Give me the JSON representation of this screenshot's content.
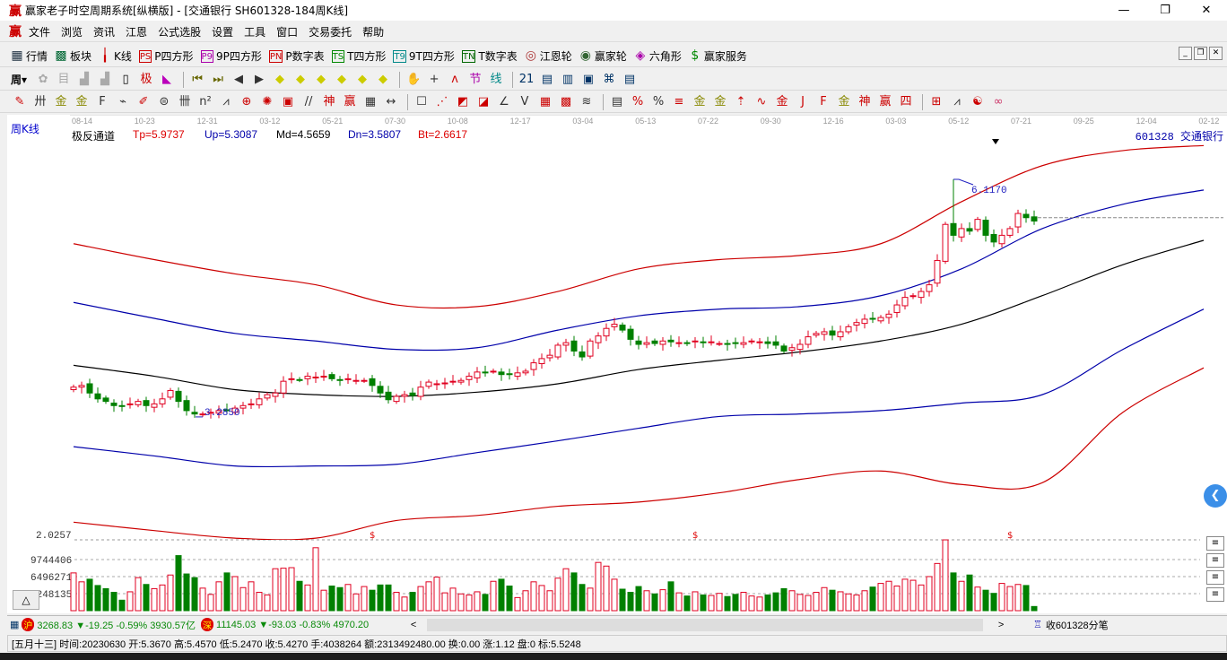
{
  "window": {
    "title": "赢家老子时空周期系统[纵横版] - [交通银行  SH601328-184周K线]",
    "logo": "赢",
    "controls": [
      "—",
      "❐",
      "✕"
    ]
  },
  "menu": {
    "logo": "赢",
    "items": [
      "文件",
      "浏览",
      "资讯",
      "江恩",
      "公式选股",
      "设置",
      "工具",
      "窗口",
      "交易委托",
      "帮助"
    ],
    "mdi_controls": [
      "_",
      "❐",
      "✕"
    ]
  },
  "toolbar1": [
    {
      "icon": "quotes-table-icon",
      "glyph": "▦",
      "label": "行情",
      "color": "#234"
    },
    {
      "icon": "sector-blocks-icon",
      "glyph": "▩",
      "label": "板块",
      "color": "#063"
    },
    {
      "icon": "kline-icon",
      "glyph": "╽",
      "label": "K线",
      "color": "#c00"
    },
    {
      "icon": "ps-icon",
      "glyph": "PS",
      "label": "P四方形",
      "color": "#c00"
    },
    {
      "icon": "p9-icon",
      "glyph": "P9",
      "label": "9P四方形",
      "color": "#a0a"
    },
    {
      "icon": "pn-icon",
      "glyph": "PN",
      "label": "P数字表",
      "color": "#c00"
    },
    {
      "icon": "ts-icon",
      "glyph": "TS",
      "label": "T四方形",
      "color": "#080"
    },
    {
      "icon": "t9-icon",
      "glyph": "T9",
      "label": "9T四方形",
      "color": "#088"
    },
    {
      "icon": "tn-icon",
      "glyph": "TN",
      "label": "T数字表",
      "color": "#060"
    },
    {
      "icon": "gann-wheel-icon",
      "glyph": "◎",
      "label": "江恩轮",
      "color": "#a33"
    },
    {
      "icon": "winner-wheel-icon",
      "glyph": "◉",
      "label": "赢家轮",
      "color": "#363"
    },
    {
      "icon": "hexagon-icon",
      "glyph": "◈",
      "label": "六角形",
      "color": "#a0a"
    },
    {
      "icon": "dollar-service-icon",
      "glyph": "$",
      "label": "赢家服务",
      "color": "#080"
    }
  ],
  "toolbar2": {
    "period": "周",
    "icons": [
      {
        "n": "formula-icon",
        "g": "✿",
        "c": "#aaa"
      },
      {
        "n": "notes-icon",
        "g": "目",
        "c": "#aaa"
      },
      {
        "n": "chart3-icon",
        "g": "▟",
        "c": "#aaa"
      },
      {
        "n": "chart9-icon",
        "g": "▟",
        "c": "#aaa"
      },
      {
        "n": "candle-type-icon",
        "g": "▯",
        "c": "#000"
      },
      {
        "n": "extreme-icon",
        "g": "极",
        "c": "#c00"
      },
      {
        "n": "color-fan-icon",
        "g": "◣",
        "c": "#b0b"
      },
      {
        "n": "sep"
      },
      {
        "n": "first-icon",
        "g": "⏮",
        "c": "#660"
      },
      {
        "n": "last-icon",
        "g": "⏭",
        "c": "#660"
      },
      {
        "n": "prev-icon",
        "g": "◀",
        "c": "#333"
      },
      {
        "n": "next-icon",
        "g": "▶",
        "c": "#333"
      },
      {
        "n": "move-left-icon",
        "g": "◆",
        "c": "#cc0"
      },
      {
        "n": "move-right-icon",
        "g": "◆",
        "c": "#cc0"
      },
      {
        "n": "zoom-in-icon",
        "g": "◆",
        "c": "#cc0"
      },
      {
        "n": "zoom-out-icon",
        "g": "◆",
        "c": "#cc0"
      },
      {
        "n": "expand-icon",
        "g": "◆",
        "c": "#cc0"
      },
      {
        "n": "vertical-icon",
        "g": "◆",
        "c": "#cc0"
      },
      {
        "n": "sep"
      },
      {
        "n": "hand-icon",
        "g": "✋",
        "c": "#333"
      },
      {
        "n": "crosshair-icon",
        "g": "+",
        "c": "#333"
      },
      {
        "n": "wave-icon",
        "g": "ʌ",
        "c": "#c00"
      },
      {
        "n": "node-icon",
        "g": "节",
        "c": "#a0a"
      },
      {
        "n": "strokes-icon",
        "g": "线",
        "c": "#088"
      },
      {
        "n": "sep"
      },
      {
        "n": "calendar-icon",
        "g": "21",
        "c": "#036"
      },
      {
        "n": "calculator-icon",
        "g": "▤",
        "c": "#036"
      },
      {
        "n": "report-icon",
        "g": "▥",
        "c": "#036"
      },
      {
        "n": "save-icon",
        "g": "▣",
        "c": "#036"
      },
      {
        "n": "network-icon",
        "g": "⌘",
        "c": "#036"
      },
      {
        "n": "print-icon",
        "g": "▤",
        "c": "#036"
      }
    ]
  },
  "toolbar3": {
    "icons": [
      {
        "n": "pen-icon",
        "g": "✎",
        "c": "#c00"
      },
      {
        "n": "hash-icon",
        "g": "卅",
        "c": "#333"
      },
      {
        "n": "gold1-icon",
        "g": "金",
        "c": "#880"
      },
      {
        "n": "gold2-icon",
        "g": "金",
        "c": "#880"
      },
      {
        "n": "f-icon",
        "g": "F",
        "c": "#333"
      },
      {
        "n": "spiral-icon",
        "g": "⌁",
        "c": "#333"
      },
      {
        "n": "brush-icon",
        "g": "✐",
        "c": "#c00"
      },
      {
        "n": "circle-icon",
        "g": "⊜",
        "c": "#333"
      },
      {
        "n": "bars-icon",
        "g": "卌",
        "c": "#333"
      },
      {
        "n": "square-icon",
        "g": "n²",
        "c": "#333"
      },
      {
        "n": "fan-icon",
        "g": "⩘",
        "c": "#333"
      },
      {
        "n": "target-icon",
        "g": "⊕",
        "c": "#c00"
      },
      {
        "n": "burst-icon",
        "g": "✺",
        "c": "#c00"
      },
      {
        "n": "box-icon",
        "g": "▣",
        "c": "#c00"
      },
      {
        "n": "slash-icon",
        "g": "//",
        "c": "#333"
      },
      {
        "n": "shen-icon",
        "g": "神",
        "c": "#c00"
      },
      {
        "n": "ying-icon",
        "g": "赢",
        "c": "#c00"
      },
      {
        "n": "grid-icon",
        "g": "▦",
        "c": "#333"
      },
      {
        "n": "span-icon",
        "g": "↔",
        "c": "#333"
      },
      {
        "n": "sep"
      },
      {
        "n": "rect-icon",
        "g": "☐",
        "c": "#333"
      },
      {
        "n": "rays-icon",
        "g": "⋰",
        "c": "#c00"
      },
      {
        "n": "fan-box-icon",
        "g": "◩",
        "c": "#c00"
      },
      {
        "n": "fan-box2-icon",
        "g": "◪",
        "c": "#c00"
      },
      {
        "n": "angle-icon",
        "g": "∠",
        "c": "#333"
      },
      {
        "n": "v-icon",
        "g": "V",
        "c": "#333"
      },
      {
        "n": "grid2-icon",
        "g": "▦",
        "c": "#c00"
      },
      {
        "n": "grid3-icon",
        "g": "▩",
        "c": "#c00"
      },
      {
        "n": "parallel-icon",
        "g": "≋",
        "c": "#333"
      },
      {
        "n": "sep"
      },
      {
        "n": "table-icon",
        "g": "▤",
        "c": "#333"
      },
      {
        "n": "percent-fan-icon",
        "g": "%",
        "c": "#c00"
      },
      {
        "n": "percent-icon",
        "g": "%",
        "c": "#333"
      },
      {
        "n": "percent-lines-icon",
        "g": "≡",
        "c": "#c00"
      },
      {
        "n": "gold-circle-icon",
        "g": "金",
        "c": "#880"
      },
      {
        "n": "gold-lines-icon",
        "g": "金",
        "c": "#880"
      },
      {
        "n": "ruler-icon",
        "g": "⇡",
        "c": "#c00"
      },
      {
        "n": "wave-box-icon",
        "g": "∿",
        "c": "#c00"
      },
      {
        "n": "gold-box-icon",
        "g": "金",
        "c": "#c00"
      },
      {
        "n": "j-angle-icon",
        "g": "J",
        "c": "#c00"
      },
      {
        "n": "f-angle-icon",
        "g": "F",
        "c": "#c00"
      },
      {
        "n": "gold-angle-icon",
        "g": "金",
        "c": "#880"
      },
      {
        "n": "shen-angle-icon",
        "g": "神",
        "c": "#c00"
      },
      {
        "n": "ying-angle-icon",
        "g": "赢",
        "c": "#c00"
      },
      {
        "n": "four-angle-icon",
        "g": "四",
        "c": "#c00"
      },
      {
        "n": "sep"
      },
      {
        "n": "grid-yellow-icon",
        "g": "⊞",
        "c": "#c00"
      },
      {
        "n": "line-chart-icon",
        "g": "⩘",
        "c": "#333"
      },
      {
        "n": "yinyang-icon",
        "g": "☯",
        "c": "#c00"
      },
      {
        "n": "infinity-icon",
        "g": "∞",
        "c": "#c36"
      }
    ]
  },
  "chart": {
    "period_label": "周K线",
    "indicator": {
      "name": "极反通道",
      "tp": "Tp=5.9737",
      "up": "Up=5.3087",
      "md": "Md=4.5659",
      "dn": "Dn=3.5807",
      "bt": "Bt=2.6617"
    },
    "stock": "601328  交通银行",
    "dates": [
      "08-14",
      "10-23",
      "12-31",
      "03-12",
      "05-21",
      "07-30",
      "10-08",
      "12-17",
      "03-04",
      "05-13",
      "07-22",
      "09-30",
      "12-16",
      "03-03",
      "05-12",
      "07-21",
      "09-25",
      "12-04",
      "02-12"
    ],
    "price_axis_label": "2.0257",
    "volume_ticks": [
      "9744406",
      "6496271",
      "3248135"
    ],
    "volume_tick_values": [
      9744406,
      6496271,
      3248135
    ],
    "colors": {
      "up": "#e00020",
      "down": "#008000",
      "upper_band": "#cc0000",
      "mid_band": "#0000aa",
      "middle": "#000000",
      "grid": "#999999",
      "label_blue": "#2020c0"
    },
    "triangle_button": "△",
    "expand_button": "❮"
  },
  "chart_data": {
    "type": "candlestick",
    "period": "weekly",
    "closes": [
      3.64,
      3.66,
      3.57,
      3.5,
      3.47,
      3.42,
      3.41,
      3.44,
      3.47,
      3.42,
      3.44,
      3.5,
      3.6,
      3.47,
      3.36,
      3.32,
      3.32,
      3.34,
      3.36,
      3.36,
      3.39,
      3.42,
      3.44,
      3.5,
      3.55,
      3.57,
      3.71,
      3.74,
      3.73,
      3.77,
      3.76,
      3.77,
      3.74,
      3.73,
      3.74,
      3.72,
      3.72,
      3.66,
      3.57,
      3.49,
      3.53,
      3.55,
      3.54,
      3.64,
      3.7,
      3.68,
      3.69,
      3.71,
      3.72,
      3.77,
      3.82,
      3.81,
      3.83,
      3.79,
      3.79,
      3.81,
      3.83,
      3.93,
      3.98,
      4.02,
      4.14,
      4.17,
      4.07,
      4.0,
      4.19,
      4.25,
      4.34,
      4.39,
      4.32,
      4.21,
      4.15,
      4.17,
      4.16,
      4.19,
      4.18,
      4.17,
      4.16,
      4.19,
      4.17,
      4.18,
      4.16,
      4.15,
      4.16,
      4.17,
      4.19,
      4.18,
      4.16,
      4.14,
      4.07,
      4.11,
      4.15,
      4.24,
      4.28,
      4.3,
      4.26,
      4.3,
      4.36,
      4.41,
      4.45,
      4.45,
      4.47,
      4.51,
      4.62,
      4.71,
      4.73,
      4.78,
      4.86,
      5.15,
      5.58,
      5.45,
      5.53,
      5.5,
      5.64,
      5.45,
      5.37,
      5.45,
      5.53,
      5.71,
      5.66,
      5.62
    ],
    "volumes_millions": [
      7.2,
      5.5,
      6.0,
      4.8,
      4.2,
      3.5,
      2.0,
      3.6,
      6.3,
      5.0,
      4.2,
      4.9,
      6.8,
      10.5,
      7.0,
      6.3,
      4.3,
      3.1,
      5.5,
      7.2,
      6.5,
      4.4,
      5.5,
      3.5,
      3.0,
      8.0,
      8.1,
      8.2,
      5.6,
      4.9,
      12.0,
      3.9,
      4.7,
      4.4,
      5.0,
      3.2,
      4.6,
      3.9,
      4.9,
      4.9,
      3.5,
      2.6,
      3.5,
      4.6,
      5.5,
      6.4,
      3.4,
      4.3,
      3.2,
      3.0,
      3.6,
      3.1,
      5.6,
      6.0,
      4.7,
      2.5,
      3.8,
      5.5,
      4.8,
      3.8,
      6.2,
      8.0,
      7.2,
      5.0,
      4.3,
      9.2,
      8.5,
      6.0,
      4.1,
      3.5,
      4.6,
      3.8,
      3.2,
      4.0,
      5.5,
      3.4,
      2.8,
      3.6,
      3.0,
      2.9,
      3.3,
      2.7,
      3.1,
      3.5,
      2.8,
      2.6,
      3.0,
      3.4,
      4.2,
      3.8,
      3.1,
      2.9,
      3.5,
      4.4,
      3.9,
      3.6,
      3.2,
      3.0,
      3.8,
      4.5,
      5.2,
      5.6,
      4.7,
      6.0,
      5.8,
      4.9,
      6.5,
      9.0,
      13.5,
      7.2,
      5.6,
      6.8,
      4.5,
      3.9,
      3.3,
      5.2,
      4.6,
      5.0,
      4.8,
      0.8
    ],
    "bands_every_10_weeks": {
      "upper_red": [
        5.35,
        5.16,
        4.99,
        4.86,
        4.62,
        4.6,
        4.78,
        5.05,
        5.16,
        5.21,
        5.35,
        5.85,
        6.28,
        6.46,
        6.52
      ],
      "upper_blue": [
        4.65,
        4.46,
        4.28,
        4.19,
        4.09,
        4.11,
        4.32,
        4.49,
        4.57,
        4.6,
        4.73,
        5.05,
        5.53,
        5.82,
        5.99
      ],
      "middle": [
        3.9,
        3.77,
        3.61,
        3.55,
        3.53,
        3.58,
        3.68,
        3.85,
        3.96,
        4.06,
        4.19,
        4.39,
        4.73,
        5.1,
        5.39
      ],
      "lower_blue": [
        2.93,
        2.82,
        2.7,
        2.7,
        2.72,
        2.86,
        3.0,
        3.15,
        3.29,
        3.32,
        3.36,
        3.45,
        3.55,
        4.09,
        4.57
      ],
      "lower_red": [
        2.03,
        1.93,
        1.84,
        1.84,
        2.05,
        2.11,
        2.22,
        2.27,
        2.38,
        2.54,
        2.64,
        2.48,
        2.5,
        3.34,
        3.87
      ]
    },
    "high_marker": {
      "week_index": 109,
      "value": 6.117,
      "label": "6.1170"
    },
    "low_marker": {
      "week_index": 16,
      "value": 3.285,
      "label": "3.2850"
    },
    "last_price_line": 5.66,
    "signal_markers": {
      "symbol": "$",
      "week_indices": [
        37,
        77,
        116
      ]
    }
  },
  "indexbar": {
    "sh_badge": "沪",
    "sh": "3268.83 ▼-19.25 -0.59% 3930.57亿",
    "sz_badge": "深",
    "sz": "11145.03 ▼-93.03 -0.83% 4970.20",
    "scroll_left": "<",
    "scroll_right": ">",
    "tick_label": "收601328分笔"
  },
  "statusbar": {
    "text": "[五月十三] 时间:20230630 开:5.3670 高:5.4570 低:5.2470 收:5.4270 手:4038264 额:2313492480.00 换:0.00 涨:1.12 盘:0 标:5.5248"
  }
}
